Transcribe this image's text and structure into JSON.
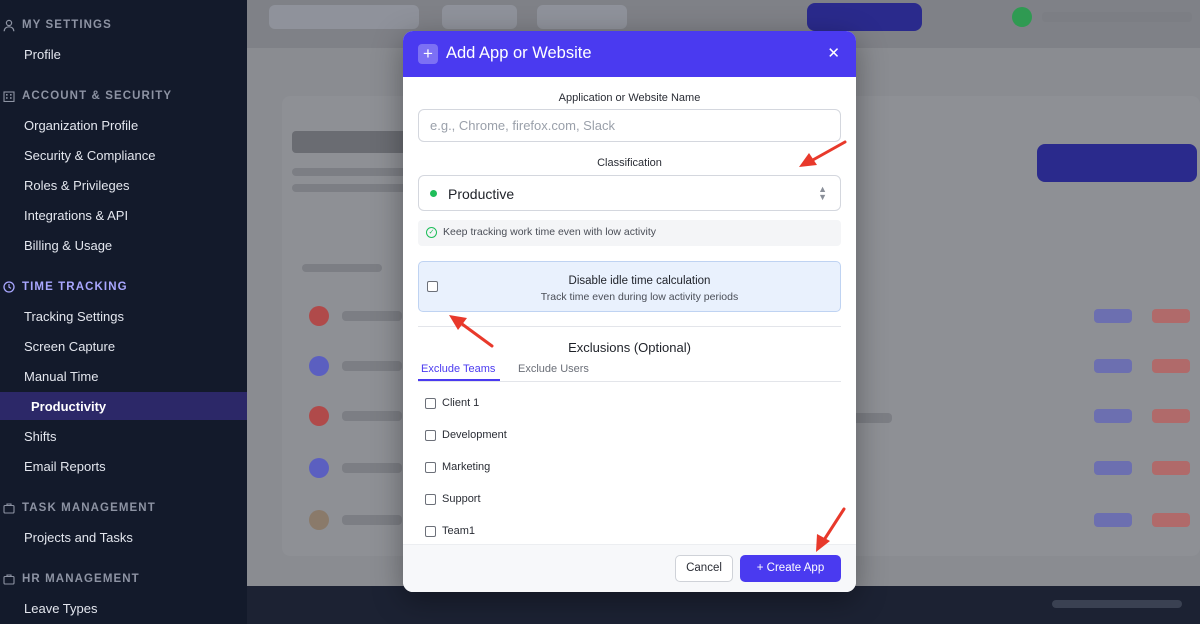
{
  "sidebar": {
    "sections": [
      {
        "title": "MY SETTINGS",
        "icon": "user-icon",
        "items": [
          "Profile"
        ]
      },
      {
        "title": "ACCOUNT & SECURITY",
        "icon": "building-icon",
        "items": [
          "Organization Profile",
          "Security & Compliance",
          "Roles & Privileges",
          "Integrations & API",
          "Billing & Usage"
        ]
      },
      {
        "title": "TIME TRACKING",
        "icon": "clock-icon",
        "items": [
          "Tracking Settings",
          "Screen Capture",
          "Manual Time",
          "Productivity",
          "Shifts",
          "Email Reports"
        ]
      },
      {
        "title": "TASK MANAGEMENT",
        "icon": "briefcase-icon",
        "items": [
          "Projects and Tasks"
        ]
      },
      {
        "title": "HR MANAGEMENT",
        "icon": "briefcase-icon",
        "items": [
          "Leave Types"
        ]
      }
    ],
    "active_item": "Productivity",
    "active_section": "TIME TRACKING"
  },
  "modal": {
    "title": "Add App or Website",
    "name_label": "Application or Website Name",
    "name_placeholder": "e.g., Chrome, firefox.com, Slack",
    "name_value": "",
    "classification_label": "Classification",
    "classification_value": "Productive",
    "classification_hint": "Keep tracking work time even with low activity",
    "idle_title": "Disable idle time calculation",
    "idle_subtitle": "Track time even during low activity periods",
    "exclusions_title": "Exclusions (Optional)",
    "tabs": [
      "Exclude Teams",
      "Exclude Users"
    ],
    "active_tab": "Exclude Teams",
    "teams": [
      "Client 1",
      "Development",
      "Marketing",
      "Support",
      "Team1"
    ],
    "cancel_label": "Cancel",
    "create_label": "+ Create App"
  },
  "colors": {
    "accent": "#4a3af0",
    "productive_dot": "#1fbe5a",
    "sidebar_bg": "#131a2b",
    "annotation_arrow": "#e8392b"
  }
}
